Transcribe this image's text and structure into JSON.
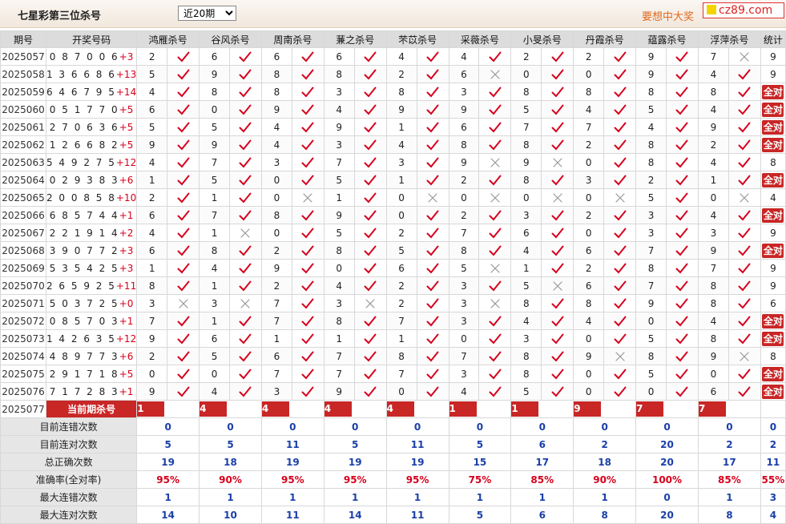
{
  "header": {
    "title": "七星彩第三位杀号",
    "period_selected": "近20期",
    "period_options": [
      "近20期"
    ],
    "slogan": "要想中大奖",
    "logo_text": "cz89.com"
  },
  "columns": {
    "issue": "期号",
    "numbers": "开奖号码",
    "experts": [
      "鸿雁杀号",
      "谷风杀号",
      "周南杀号",
      "蒹之杀号",
      "芣苡杀号",
      "采薇杀号",
      "小旻杀号",
      "丹霞杀号",
      "蕴露杀号",
      "浮萍杀号"
    ],
    "stat": "统计"
  },
  "rows": [
    {
      "issue": "2025057",
      "digits": "087006",
      "sum": "+3",
      "kills": [
        2,
        6,
        6,
        6,
        4,
        4,
        2,
        2,
        9,
        7
      ],
      "ok": [
        1,
        1,
        1,
        1,
        1,
        1,
        1,
        1,
        1,
        0
      ],
      "stat": "9"
    },
    {
      "issue": "2025058",
      "digits": "136686",
      "sum": "+13",
      "kills": [
        5,
        9,
        8,
        8,
        2,
        6,
        0,
        0,
        9,
        4
      ],
      "ok": [
        1,
        1,
        1,
        1,
        1,
        0,
        1,
        1,
        1,
        1
      ],
      "stat": "9"
    },
    {
      "issue": "2025059",
      "digits": "646795",
      "sum": "+14",
      "kills": [
        4,
        8,
        8,
        3,
        8,
        3,
        8,
        8,
        8,
        8
      ],
      "ok": [
        1,
        1,
        1,
        1,
        1,
        1,
        1,
        1,
        1,
        1
      ],
      "stat": "全对"
    },
    {
      "issue": "2025060",
      "digits": "051770",
      "sum": "+5",
      "kills": [
        6,
        0,
        9,
        4,
        9,
        9,
        5,
        4,
        5,
        4
      ],
      "ok": [
        1,
        1,
        1,
        1,
        1,
        1,
        1,
        1,
        1,
        1
      ],
      "stat": "全对"
    },
    {
      "issue": "2025061",
      "digits": "270636",
      "sum": "+5",
      "kills": [
        5,
        5,
        4,
        9,
        1,
        6,
        7,
        7,
        4,
        9
      ],
      "ok": [
        1,
        1,
        1,
        1,
        1,
        1,
        1,
        1,
        1,
        1
      ],
      "stat": "全对"
    },
    {
      "issue": "2025062",
      "digits": "126682",
      "sum": "+5",
      "kills": [
        9,
        9,
        4,
        3,
        4,
        8,
        8,
        2,
        8,
        2
      ],
      "ok": [
        1,
        1,
        1,
        1,
        1,
        1,
        1,
        1,
        1,
        1
      ],
      "stat": "全对"
    },
    {
      "issue": "2025063",
      "digits": "549275",
      "sum": "+12",
      "kills": [
        4,
        7,
        3,
        7,
        3,
        9,
        9,
        0,
        8,
        4
      ],
      "ok": [
        1,
        1,
        1,
        1,
        1,
        0,
        0,
        1,
        1,
        1
      ],
      "stat": "8"
    },
    {
      "issue": "2025064",
      "digits": "029383",
      "sum": "+6",
      "kills": [
        1,
        5,
        0,
        5,
        1,
        2,
        8,
        3,
        2,
        1
      ],
      "ok": [
        1,
        1,
        1,
        1,
        1,
        1,
        1,
        1,
        1,
        1
      ],
      "stat": "全对"
    },
    {
      "issue": "2025065",
      "digits": "200858",
      "sum": "+10",
      "kills": [
        2,
        1,
        0,
        1,
        0,
        0,
        0,
        0,
        5,
        0
      ],
      "ok": [
        1,
        1,
        0,
        1,
        0,
        0,
        0,
        0,
        1,
        0
      ],
      "stat": "4"
    },
    {
      "issue": "2025066",
      "digits": "685744",
      "sum": "+1",
      "kills": [
        6,
        7,
        8,
        9,
        0,
        2,
        3,
        2,
        3,
        4
      ],
      "ok": [
        1,
        1,
        1,
        1,
        1,
        1,
        1,
        1,
        1,
        1
      ],
      "stat": "全对"
    },
    {
      "issue": "2025067",
      "digits": "221914",
      "sum": "+2",
      "kills": [
        4,
        1,
        0,
        5,
        2,
        7,
        6,
        0,
        3,
        3
      ],
      "ok": [
        1,
        0,
        1,
        1,
        1,
        1,
        1,
        1,
        1,
        1
      ],
      "stat": "9"
    },
    {
      "issue": "2025068",
      "digits": "390772",
      "sum": "+3",
      "kills": [
        6,
        8,
        2,
        8,
        5,
        8,
        4,
        6,
        7,
        9
      ],
      "ok": [
        1,
        1,
        1,
        1,
        1,
        1,
        1,
        1,
        1,
        1
      ],
      "stat": "全对"
    },
    {
      "issue": "2025069",
      "digits": "535425",
      "sum": "+3",
      "kills": [
        1,
        4,
        9,
        0,
        6,
        5,
        1,
        2,
        8,
        7
      ],
      "ok": [
        1,
        1,
        1,
        1,
        1,
        0,
        1,
        1,
        1,
        1
      ],
      "stat": "9"
    },
    {
      "issue": "2025070",
      "digits": "265925",
      "sum": "+11",
      "kills": [
        8,
        1,
        2,
        4,
        2,
        3,
        5,
        6,
        7,
        8
      ],
      "ok": [
        1,
        1,
        1,
        1,
        1,
        1,
        0,
        1,
        1,
        1
      ],
      "stat": "9"
    },
    {
      "issue": "2025071",
      "digits": "503725",
      "sum": "+0",
      "kills": [
        3,
        3,
        7,
        3,
        2,
        3,
        8,
        8,
        9,
        8
      ],
      "ok": [
        0,
        0,
        1,
        0,
        1,
        0,
        1,
        1,
        1,
        1
      ],
      "stat": "6"
    },
    {
      "issue": "2025072",
      "digits": "085703",
      "sum": "+1",
      "kills": [
        7,
        1,
        7,
        8,
        7,
        3,
        4,
        4,
        0,
        4
      ],
      "ok": [
        1,
        1,
        1,
        1,
        1,
        1,
        1,
        1,
        1,
        1
      ],
      "stat": "全对"
    },
    {
      "issue": "2025073",
      "digits": "142635",
      "sum": "+12",
      "kills": [
        9,
        6,
        1,
        1,
        1,
        0,
        3,
        0,
        5,
        8
      ],
      "ok": [
        1,
        1,
        1,
        1,
        1,
        1,
        1,
        1,
        1,
        1
      ],
      "stat": "全对"
    },
    {
      "issue": "2025074",
      "digits": "489773",
      "sum": "+6",
      "kills": [
        2,
        5,
        6,
        7,
        8,
        7,
        8,
        9,
        8,
        9
      ],
      "ok": [
        1,
        1,
        1,
        1,
        1,
        1,
        1,
        0,
        1,
        0
      ],
      "stat": "8"
    },
    {
      "issue": "2025075",
      "digits": "291718",
      "sum": "+5",
      "kills": [
        0,
        0,
        7,
        7,
        7,
        3,
        8,
        0,
        5,
        0
      ],
      "ok": [
        1,
        1,
        1,
        1,
        1,
        1,
        1,
        1,
        1,
        1
      ],
      "stat": "全对"
    },
    {
      "issue": "2025076",
      "digits": "717283",
      "sum": "+1",
      "kills": [
        9,
        4,
        3,
        9,
        0,
        4,
        5,
        0,
        0,
        6
      ],
      "ok": [
        1,
        1,
        1,
        1,
        1,
        1,
        1,
        1,
        1,
        1
      ],
      "stat": "全对"
    }
  ],
  "prediction": {
    "issue": "2025077",
    "label": "当前期杀号",
    "values": [
      "1",
      "4",
      "4",
      "4",
      "4",
      "1",
      "1",
      "9",
      "7",
      "7"
    ]
  },
  "summary": [
    {
      "label": "目前连错次数",
      "values": [
        "0",
        "0",
        "0",
        "0",
        "0",
        "0",
        "0",
        "0",
        "0",
        "0"
      ],
      "stat": "0",
      "red": false
    },
    {
      "label": "目前连对次数",
      "values": [
        "5",
        "5",
        "11",
        "5",
        "11",
        "5",
        "6",
        "2",
        "20",
        "2"
      ],
      "stat": "2",
      "red": false
    },
    {
      "label": "总正确次数",
      "values": [
        "19",
        "18",
        "19",
        "19",
        "19",
        "15",
        "17",
        "18",
        "20",
        "17"
      ],
      "stat": "11",
      "red": false
    },
    {
      "label": "准确率(全对率)",
      "values": [
        "95%",
        "90%",
        "95%",
        "95%",
        "95%",
        "75%",
        "85%",
        "90%",
        "100%",
        "85%"
      ],
      "stat": "55%",
      "red": true
    },
    {
      "label": "最大连错次数",
      "values": [
        "1",
        "1",
        "1",
        "1",
        "1",
        "1",
        "1",
        "1",
        "0",
        "1"
      ],
      "stat": "3",
      "red": false
    },
    {
      "label": "最大连对次数",
      "values": [
        "14",
        "10",
        "11",
        "14",
        "11",
        "5",
        "6",
        "8",
        "20",
        "8"
      ],
      "stat": "4",
      "red": false
    }
  ],
  "colors": {
    "accent": "#c92626",
    "blue": "#1a3fa8",
    "check": "#d6001c",
    "cross": "#999999"
  }
}
